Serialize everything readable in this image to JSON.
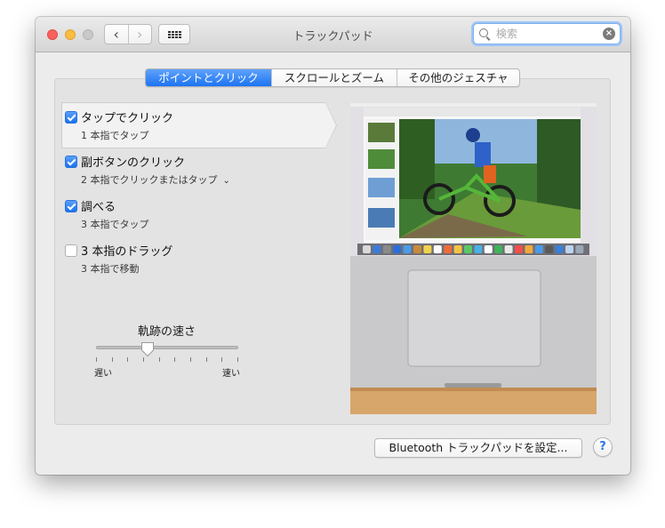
{
  "window": {
    "title": "トラックパッド"
  },
  "search": {
    "placeholder": "検索",
    "value": ""
  },
  "tabs": [
    {
      "label": "ポイントとクリック",
      "active": true
    },
    {
      "label": "スクロールとズーム",
      "active": false
    },
    {
      "label": "その他のジェスチャ",
      "active": false
    }
  ],
  "options": [
    {
      "title": "タップでクリック",
      "subtitle": "1 本指でタップ",
      "checked": true,
      "selected": true
    },
    {
      "title": "副ボタンのクリック",
      "subtitle": "2 本指でクリックまたはタップ",
      "checked": true,
      "has_dropdown": true
    },
    {
      "title": "調べる",
      "subtitle": "3 本指でタップ",
      "checked": true
    },
    {
      "title": "3 本指のドラッグ",
      "subtitle": "3 本指で移動",
      "checked": false
    }
  ],
  "tracking_speed": {
    "label": "軌跡の速さ",
    "min_label": "遅い",
    "max_label": "速い",
    "level": 0.36
  },
  "buttons": {
    "bluetooth": "Bluetooth トラックパッドを設定...",
    "help": "?"
  },
  "colors": {
    "accent": "#1c73f2",
    "checkbox_on": "#2f7ff4"
  },
  "icons": {
    "back": "chevron-left-icon",
    "forward": "chevron-right-icon",
    "grid": "grid-icon",
    "search": "search-icon",
    "clear": "clear-icon"
  }
}
